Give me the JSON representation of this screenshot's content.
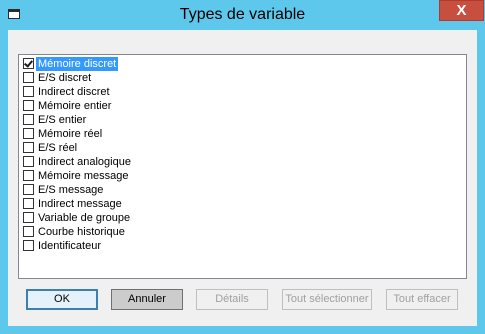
{
  "window": {
    "title": "Types de variable",
    "close_label": "X"
  },
  "list": {
    "items": [
      {
        "label": "Mémoire discret",
        "checked": true,
        "selected": true
      },
      {
        "label": "E/S discret",
        "checked": false
      },
      {
        "label": "Indirect discret",
        "checked": false
      },
      {
        "label": "Mémoire entier",
        "checked": false
      },
      {
        "label": "E/S entier",
        "checked": false
      },
      {
        "label": "Mémoire réel",
        "checked": false
      },
      {
        "label": "E/S réel",
        "checked": false
      },
      {
        "label": "Indirect analogique",
        "checked": false
      },
      {
        "label": "Mémoire message",
        "checked": false
      },
      {
        "label": "E/S message",
        "checked": false
      },
      {
        "label": "Indirect message",
        "checked": false
      },
      {
        "label": "Variable de groupe",
        "checked": false
      },
      {
        "label": "Courbe historique",
        "checked": false
      },
      {
        "label": "Identificateur",
        "checked": false
      }
    ]
  },
  "buttons": {
    "ok": "OK",
    "cancel": "Annuler",
    "details": "Détails",
    "select_all": "Tout sélectionner",
    "clear_all": "Tout effacer"
  },
  "colors": {
    "title_bar": "#5ec8ec",
    "close_button": "#c74f3f",
    "selection": "#3399ff"
  }
}
